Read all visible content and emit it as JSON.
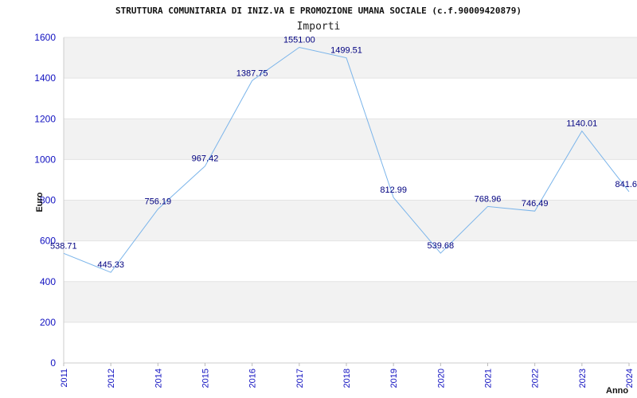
{
  "chart_data": {
    "type": "line",
    "title": "STRUTTURA COMUNITARIA DI INIZ.VA E PROMOZIONE UMANA SOCIALE (c.f.90009420879)",
    "subtitle": "Importi",
    "xlabel": "Anno",
    "ylabel": "Euro",
    "ylim": [
      0,
      1600
    ],
    "yticks": [
      "0",
      "200",
      "400",
      "600",
      "800",
      "1000",
      "1200",
      "1400",
      "1600"
    ],
    "grid": "horizontal banded",
    "categories": [
      "2011",
      "2012",
      "2014",
      "2015",
      "2016",
      "2017",
      "2018",
      "2019",
      "2020",
      "2021",
      "2022",
      "2023",
      "2024"
    ],
    "values": [
      538.71,
      445.33,
      756.19,
      967.42,
      1387.75,
      1551.0,
      1499.51,
      812.99,
      539.68,
      768.96,
      746.49,
      1140.01,
      841.6
    ],
    "labels": [
      "538.71",
      "445.33",
      "756.19",
      "967.42",
      "1387.75",
      "1551.00",
      "1499.51",
      "812.99",
      "539.68",
      "768.96",
      "746.49",
      "1140.01",
      "841.6"
    ],
    "line_color": "#7ab4ea",
    "band_color": "#f2f2f2"
  }
}
